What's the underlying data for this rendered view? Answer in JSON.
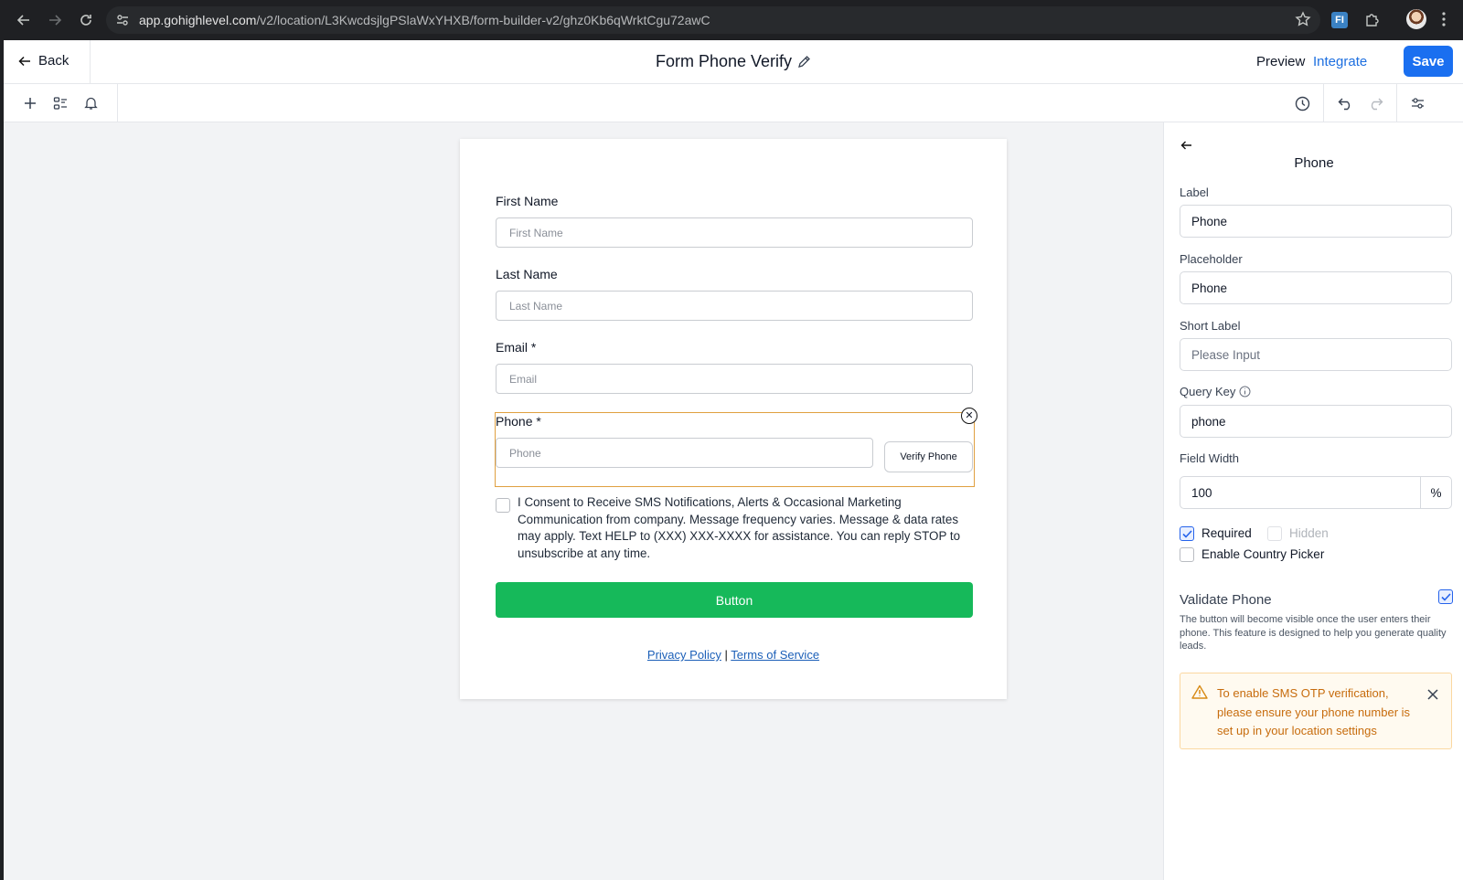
{
  "browser": {
    "url_host": "app.gohighlevel.com",
    "url_path": "/v2/location/L3KwcdsjlgPSlaWxYHXB/form-builder-v2/ghz0Kb6qWrktCgu72awC",
    "extension_label": "FI"
  },
  "header": {
    "back_label": "Back",
    "title": "Form Phone Verify",
    "preview_label": "Preview",
    "integrate_label": "Integrate",
    "save_label": "Save",
    "save_color": "#1a6ff0"
  },
  "form": {
    "fields": [
      {
        "label": "First Name",
        "placeholder": "First Name"
      },
      {
        "label": "Last Name",
        "placeholder": "Last Name"
      },
      {
        "label": "Email *",
        "placeholder": "Email"
      }
    ],
    "phone": {
      "label": "Phone *",
      "placeholder": "Phone",
      "verify_label": "Verify Phone"
    },
    "consent": "I Consent to Receive SMS Notifications, Alerts & Occasional Marketing Communication from company. Message frequency varies. Message & data rates may apply. Text HELP to (XXX) XXX-XXXX for assistance. You can reply STOP to unsubscribe at any time.",
    "button_label": "Button",
    "button_color": "#16b95a",
    "privacy_label": "Privacy Policy",
    "separator": "|",
    "terms_label": "Terms of Service"
  },
  "panel": {
    "title": "Phone",
    "label_title": "Label",
    "label_value": "Phone",
    "placeholder_title": "Placeholder",
    "placeholder_value": "Phone",
    "short_label_title": "Short Label",
    "short_label_placeholder": "Please Input",
    "query_key_title": "Query Key",
    "query_key_value": "phone",
    "field_width_title": "Field Width",
    "field_width_value": "100",
    "field_width_unit": "%",
    "required_label": "Required",
    "required_checked": true,
    "hidden_label": "Hidden",
    "hidden_checked": false,
    "country_picker_label": "Enable Country Picker",
    "country_picker_checked": false,
    "validate_title": "Validate Phone",
    "validate_checked": true,
    "validate_desc": "The button will become visible once the user enters their phone. This feature is designed to help you generate quality leads.",
    "warning_text": "To enable SMS OTP verification, please ensure your phone number is set up in your location settings"
  }
}
